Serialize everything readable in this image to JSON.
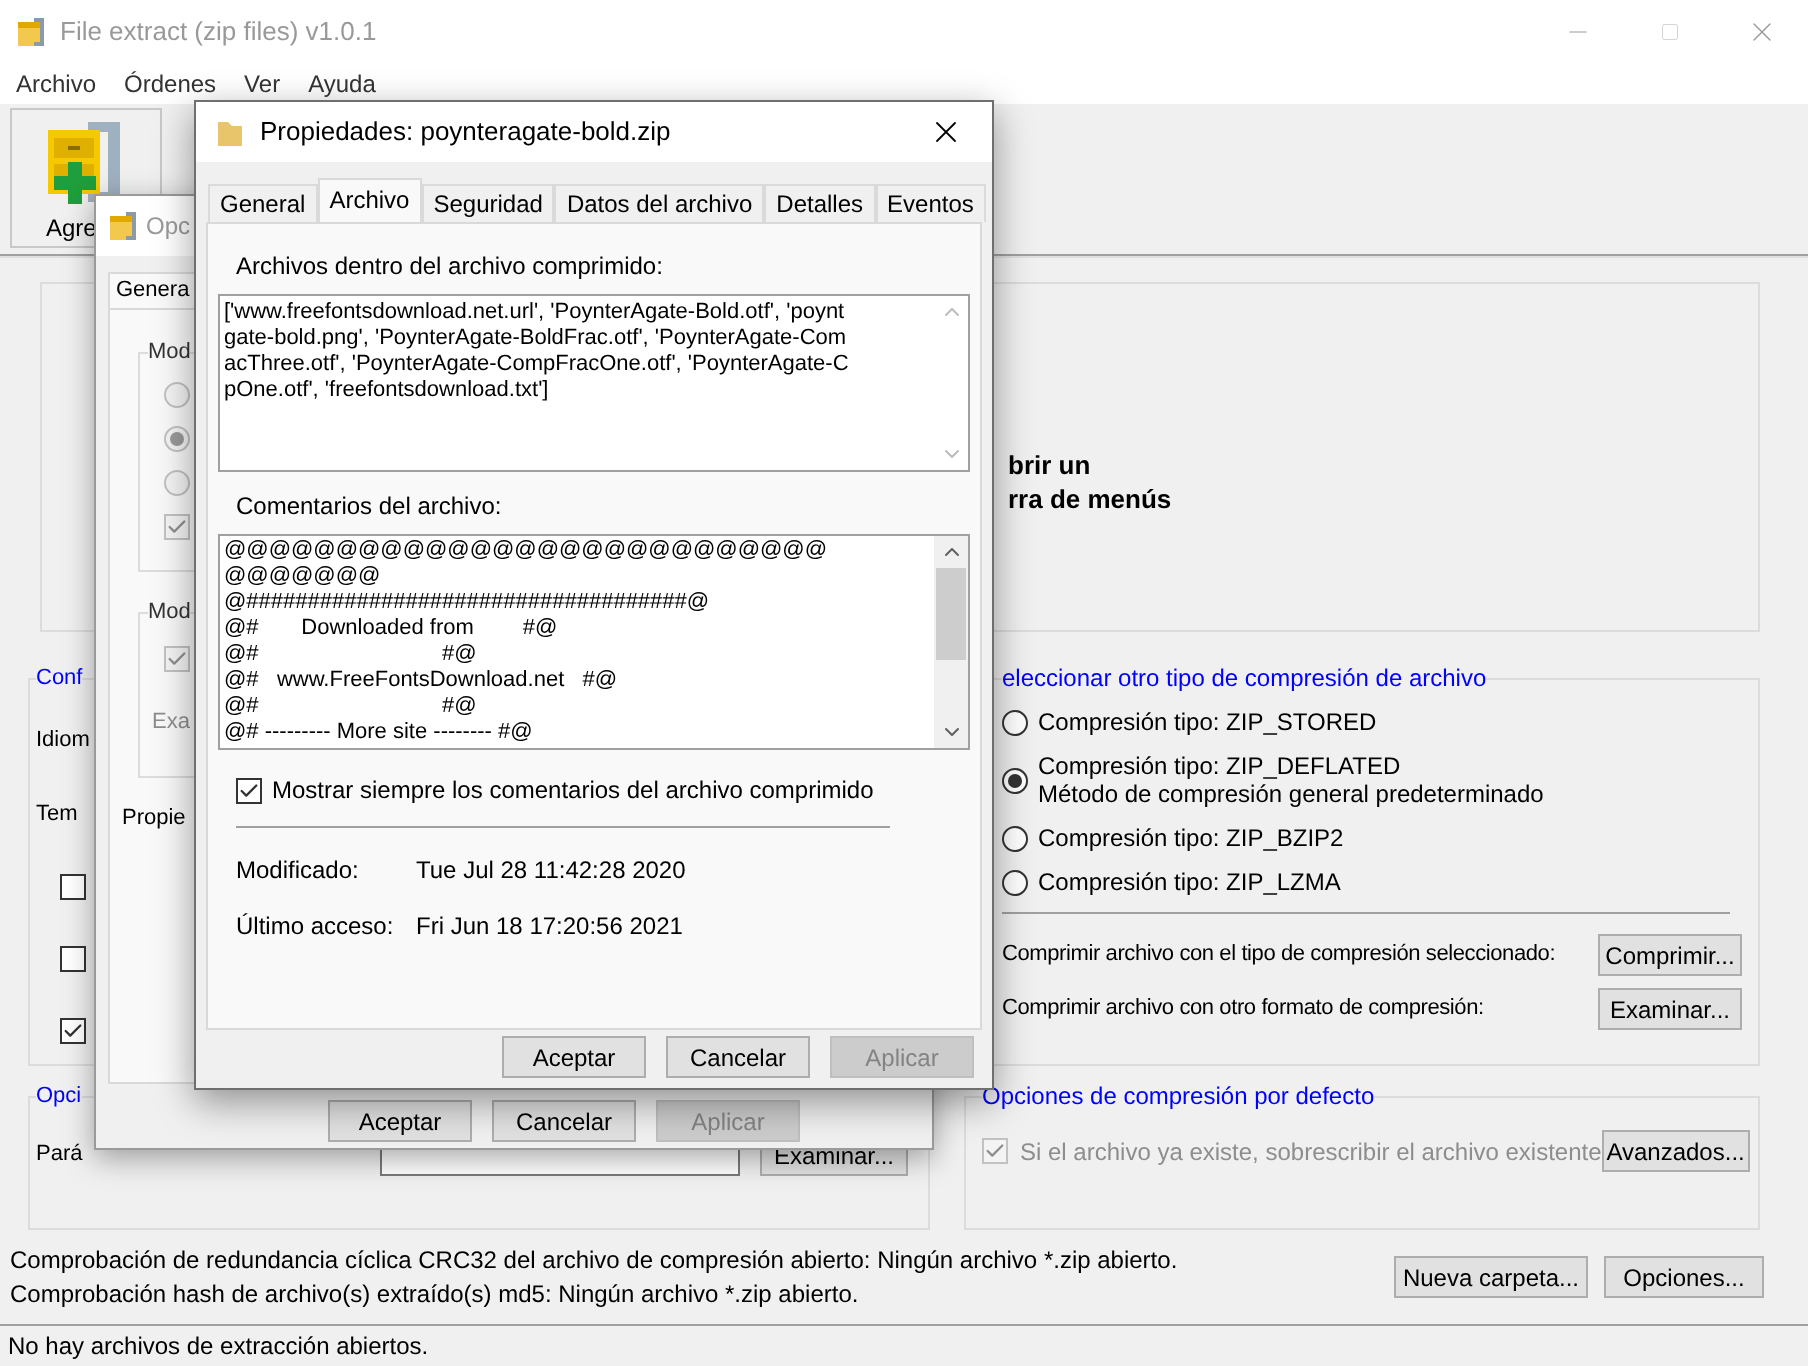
{
  "main_window": {
    "title": "File extract (zip files) v1.0.1",
    "menu": [
      "Archivo",
      "Órdenes",
      "Ver",
      "Ayuda"
    ],
    "toolbar": [
      {
        "label": "Agre"
      }
    ],
    "info_box": {
      "lines": [
        "brir un",
        "rra de menús"
      ]
    },
    "config_group": {
      "title": "Conf",
      "labels": [
        "Idiom",
        "Tem"
      ],
      "checkboxes": [
        {
          "checked": false
        },
        {
          "checked": false
        },
        {
          "checked": true
        }
      ]
    },
    "compression_group": {
      "title": "eleccionar otro tipo de compresión de archivo",
      "options": [
        {
          "label": "Compresión tipo: ZIP_STORED",
          "selected": false
        },
        {
          "label": "Compresión tipo: ZIP_DEFLATED",
          "note": "Método de compresión general predeterminado",
          "selected": true
        },
        {
          "label": "Compresión tipo: ZIP_BZIP2",
          "selected": false
        },
        {
          "label": "Compresión tipo: ZIP_LZMA",
          "selected": false
        }
      ],
      "actions": [
        {
          "label": "Comprimir archivo con el tipo de compresión seleccionado:",
          "button": "Comprimir..."
        },
        {
          "label": "Comprimir archivo con otro formato de compresión:",
          "button": "Examinar..."
        }
      ]
    },
    "options_group": {
      "title": "Opci",
      "label": "Pará",
      "button": "Examinar..."
    },
    "defaults_group": {
      "title": "Opciones de compresión por defecto",
      "checkbox": {
        "label": "Si el archivo ya existe, sobrescribir el archivo existente",
        "checked": true,
        "disabled": true
      },
      "button": "Avanzados..."
    },
    "checksums": [
      "Comprobación de redundancia cíclica CRC32 del archivo de compresión abierto: Ningún archivo *.zip abierto.",
      "Comprobación hash de archivo(s) extraído(s) md5: Ningún archivo *.zip abierto."
    ],
    "buttons": [
      "Nueva carpeta...",
      "Opciones..."
    ],
    "status_bar": "No hay archivos de extracción abiertos."
  },
  "options_dialog": {
    "title": "Opc",
    "tabs": [
      {
        "label": "Genera",
        "selected": true
      }
    ],
    "groups": [
      {
        "title": "Mod",
        "disabled": true,
        "items": [
          {
            "kind": "radio",
            "selected": false
          },
          {
            "kind": "radio",
            "selected": true
          },
          {
            "kind": "radio",
            "selected": false
          },
          {
            "kind": "checkbox",
            "checked": true
          }
        ]
      },
      {
        "title": "Mod",
        "disabled": true,
        "items": [
          {
            "kind": "checkbox",
            "checked": true
          },
          {
            "kind": "text",
            "label": "Exa"
          }
        ]
      }
    ],
    "label": "Propie",
    "buttons": [
      {
        "label": "Aceptar",
        "disabled": false
      },
      {
        "label": "Cancelar",
        "disabled": false
      },
      {
        "label": "Aplicar",
        "disabled": true
      }
    ]
  },
  "properties_dialog": {
    "title": "Propiedades: poynteragate-bold.zip",
    "tabs": [
      {
        "label": "General",
        "selected": false
      },
      {
        "label": "Archivo",
        "selected": true
      },
      {
        "label": "Seguridad",
        "selected": false
      },
      {
        "label": "Datos del archivo",
        "selected": false
      },
      {
        "label": "Detalles",
        "selected": false
      },
      {
        "label": "Eventos",
        "selected": false
      }
    ],
    "files_label": "Archivos dentro del archivo comprimido:",
    "files_lines": [
      "['www.freefontsdownload.net.url', 'PoynterAgate-Bold.otf', 'poynt",
      "gate-bold.png', 'PoynterAgate-BoldFrac.otf', 'PoynterAgate-Com",
      "acThree.otf', 'PoynterAgate-CompFracOne.otf', 'PoynterAgate-C",
      "pOne.otf', 'freefontsdownload.txt']"
    ],
    "comments_label": "Comentarios del archivo:",
    "comments_lines": [
      "@@@@@@@@@@@@@@@@@@@@@@@@@@@",
      "@@@@@@@",
      "@####################################@",
      "@#       Downloaded from        #@",
      "@#                              #@",
      "@#   www.FreeFontsDownload.net   #@",
      "@#                              #@",
      "@# --------- More site -------- #@"
    ],
    "show_comments": {
      "label": "Mostrar siempre los comentarios del archivo comprimido",
      "checked": true
    },
    "info": [
      {
        "label": "Modificado:",
        "value": "Tue Jul 28 11:42:28 2020"
      },
      {
        "label": "Último acceso:",
        "value": "Fri Jun 18 17:20:56 2021"
      }
    ],
    "buttons": [
      {
        "label": "Aceptar",
        "disabled": false
      },
      {
        "label": "Cancelar",
        "disabled": false
      },
      {
        "label": "Aplicar",
        "disabled": true
      }
    ]
  }
}
